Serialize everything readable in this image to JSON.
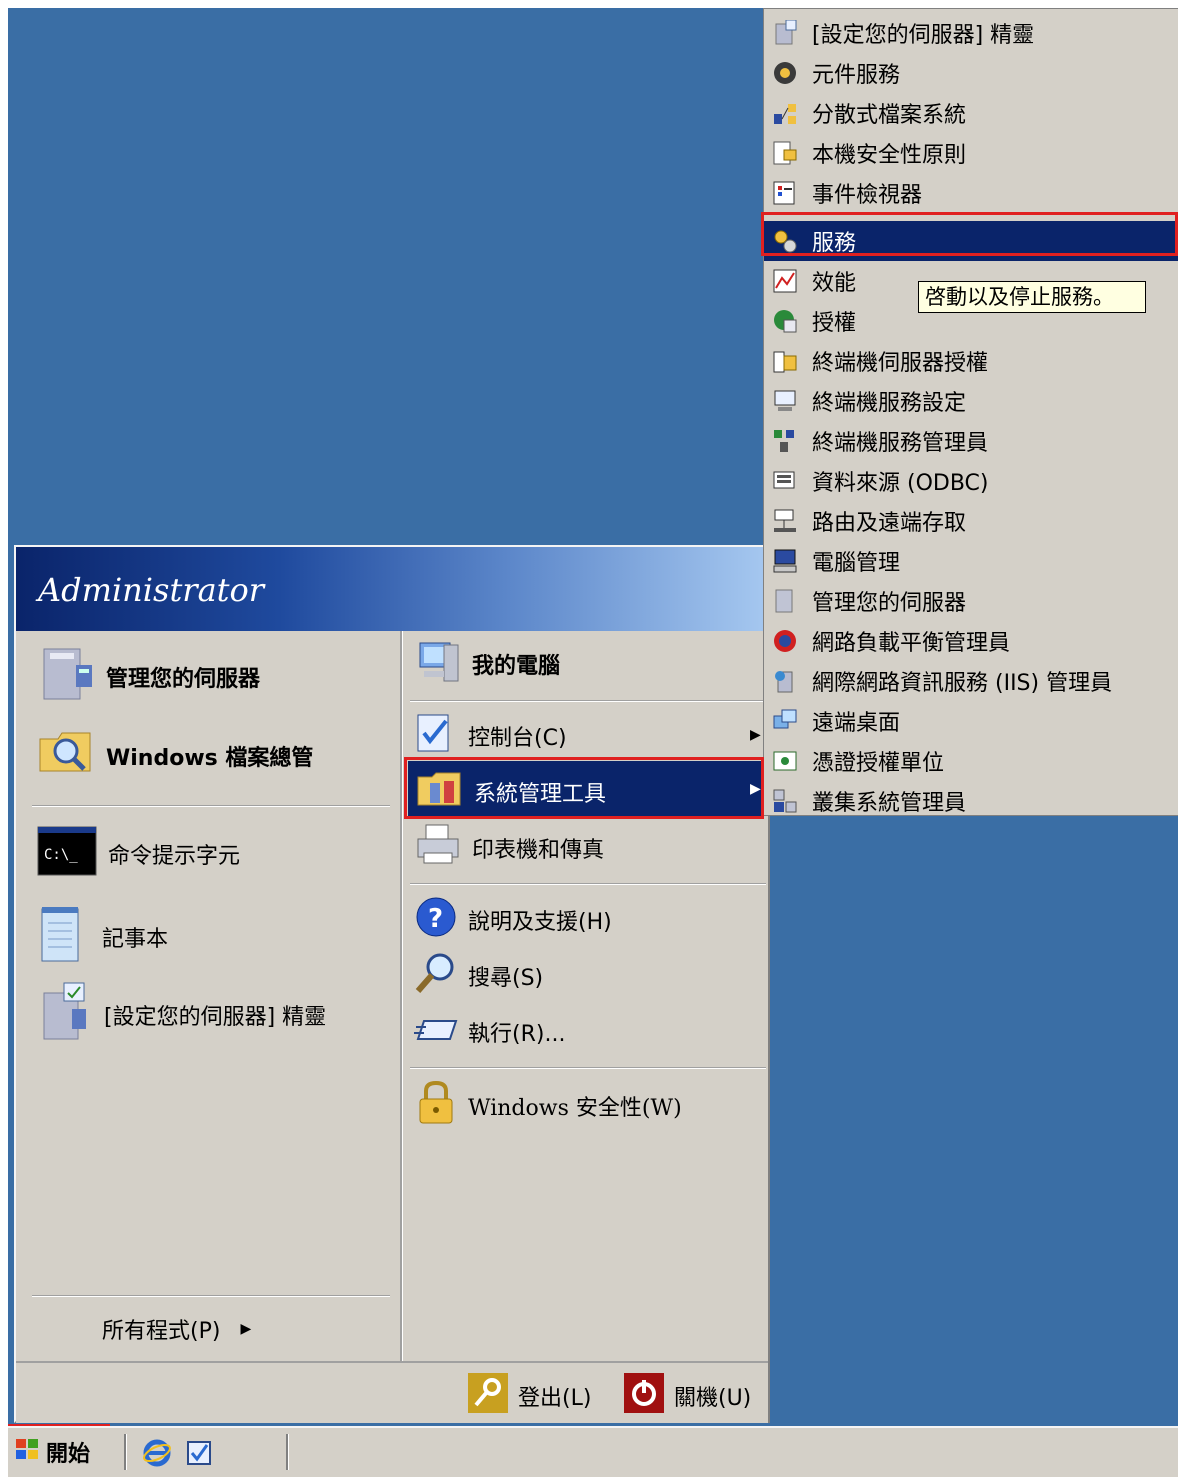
{
  "start_menu": {
    "user_name": "Administrator",
    "left_pinned": [
      {
        "label": "管理您的伺服器",
        "icon": "server-manage-icon"
      },
      {
        "label": "Windows 檔案總管",
        "icon": "explorer-folder-icon"
      }
    ],
    "left_recent": [
      {
        "label": "命令提示字元",
        "icon": "command-prompt-icon"
      },
      {
        "label": "記事本",
        "icon": "notepad-icon"
      },
      {
        "label": "[設定您的伺服器] 精靈",
        "icon": "configure-server-wizard-icon"
      }
    ],
    "all_programs": "所有程式(P)",
    "right_items": [
      {
        "label": "我的電腦",
        "icon": "my-computer-icon"
      },
      {
        "label": "控制台(C)",
        "icon": "control-panel-icon"
      },
      {
        "label": "系統管理工具",
        "icon": "admin-tools-icon"
      },
      {
        "label": "印表機和傳真",
        "icon": "printer-icon"
      },
      {
        "label": "說明及支援(H)",
        "icon": "help-icon"
      },
      {
        "label": "搜尋(S)",
        "icon": "search-icon"
      },
      {
        "label": "執行(R)...",
        "icon": "run-icon"
      },
      {
        "label": "Windows 安全性(W)",
        "icon": "lock-icon"
      }
    ],
    "logoff": "登出(L)",
    "shutdown": "關機(U)"
  },
  "submenu": {
    "items": [
      "[設定您的伺服器] 精靈",
      "元件服務",
      "分散式檔案系統",
      "本機安全性原則",
      "事件檢視器",
      "服務",
      "效能",
      "授權",
      "終端機伺服器授權",
      "終端機服務設定",
      "終端機服務管理員",
      "資料來源 (ODBC)",
      "路由及遠端存取",
      "電腦管理",
      "管理您的伺服器",
      "網路負載平衡管理員",
      "網際網路資訊服務 (IIS) 管理員",
      "遠端桌面",
      "憑證授權單位",
      "叢集系統管理員"
    ],
    "selected_index": 5,
    "tooltip": "啓動以及停止服務。"
  },
  "taskbar": {
    "start_label": "開始"
  },
  "colors": {
    "desktop": "#3a6ea5",
    "selection": "#0a246a",
    "menu_face": "#d4d0c8",
    "highlight_box": "#e02020",
    "tooltip_bg": "#ffffe1"
  }
}
